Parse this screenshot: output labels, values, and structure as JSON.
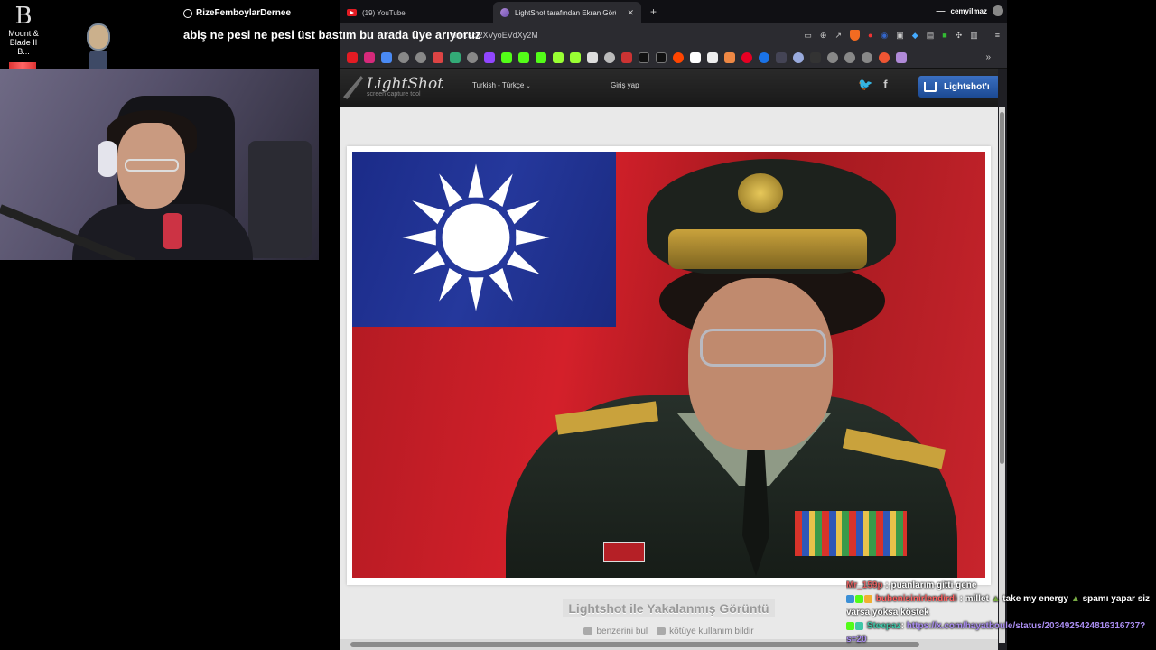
{
  "desktop": {
    "icon_label": "Mount &\nBlade II B...",
    "icon_glyph": "B"
  },
  "donation": {
    "donor_name": "RizeFemboylarDernee",
    "message": "abiş ne pesi ne pesi üst bastım bu arada üye arıyoruz"
  },
  "browser": {
    "tabs": [
      {
        "label": "(19) YouTube",
        "icon": "youtube-icon"
      },
      {
        "label": "LightShot tarafından Ekran Görü",
        "icon": "lightshot-icon",
        "active": true
      }
    ],
    "new_tab_glyph": "+",
    "profile_name": "cemyilmaz",
    "url": "prnt.sc/2XVyoEVdXy2M",
    "more_glyph": "»"
  },
  "lightshot": {
    "logo_name": "LightShot",
    "logo_tagline": "screen capture tool",
    "language": "Turkish - Türkçe",
    "login": "Giriş yap",
    "install_label": "Lightshot'ı",
    "caption_title": "Lightshot ile Yakalanmış Görüntü",
    "link_similar": "benzerini bul",
    "link_report": "kötüye kullanım bildir"
  },
  "chat": [
    {
      "user": "Mr_159p",
      "text": ": puanlarım gitti gene"
    },
    {
      "user": "bubenisinirlendirdi",
      "text": ": millet",
      "extra": "take my energy",
      "extra2": "spamı yapar siz"
    },
    {
      "text": "varsa yoksa köstek"
    },
    {
      "user": "Steepaz",
      "text": ": ",
      "link": "https://x.com/hayatboule/status/2034925424816316737?"
    },
    {
      "text": "s=20"
    }
  ],
  "colors": {
    "lightshot_blue": "#1c4a94",
    "youtube_red": "#e31b23",
    "chat_link": "#a98cf0"
  }
}
